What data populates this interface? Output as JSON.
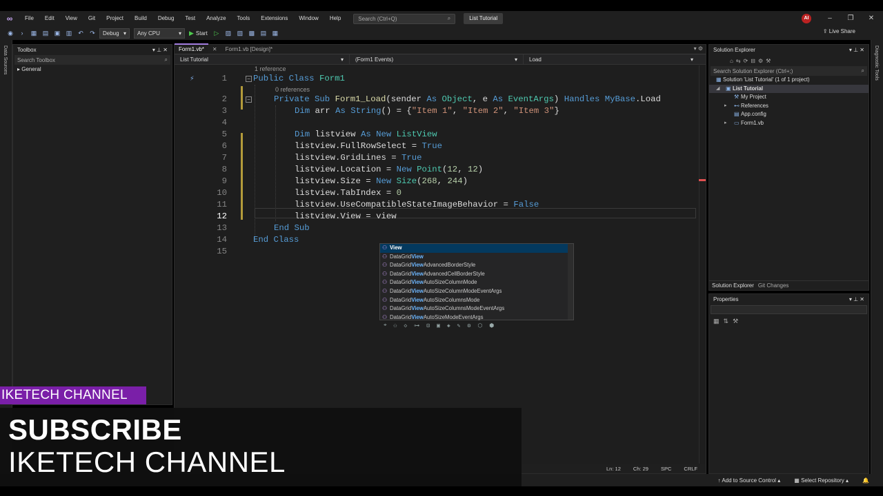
{
  "menu": {
    "items": [
      "File",
      "Edit",
      "View",
      "Git",
      "Project",
      "Build",
      "Debug",
      "Test",
      "Analyze",
      "Tools",
      "Extensions",
      "Window",
      "Help"
    ],
    "search_placeholder": "Search (Ctrl+Q)",
    "solution_name": "List Tutorial",
    "avatar": "AI"
  },
  "toolbar": {
    "config": "Debug",
    "platform": "Any CPU",
    "start_label": "Start",
    "live_share": "Live Share"
  },
  "left_strip": {
    "label": "Data Sources"
  },
  "right_strip": {
    "label": "Diagnostic Tools"
  },
  "toolbox": {
    "title": "Toolbox",
    "search_placeholder": "Search Toolbox",
    "group": "General"
  },
  "editor": {
    "tabs": [
      "Form1.vb*",
      "Form1.vb [Design]*"
    ],
    "nav": [
      "List Tutorial",
      "(Form1 Events)",
      "Load"
    ],
    "refs": {
      "r1": "1 reference",
      "r2": "0 references"
    },
    "line_numbers": [
      "1",
      "2",
      "3",
      "4",
      "5",
      "6",
      "7",
      "8",
      "9",
      "10",
      "11",
      "12",
      "13",
      "14",
      "15"
    ],
    "lines": {
      "l1_kw": "Public Class ",
      "l1_cls": "Form1",
      "l2_kw1": "Private Sub ",
      "l2_fn": "Form1_Load",
      "l2_p1": "(sender ",
      "l2_kw2": "As ",
      "l2_cls1": "Object",
      "l2_p2": ", e ",
      "l2_kw3": "As ",
      "l2_cls2": "EventArgs",
      "l2_p3": ") ",
      "l2_kw4": "Handles ",
      "l2_kw5": "MyBase",
      "l2_p4": ".Load",
      "l3_kw1": "Dim ",
      "l3_p1": "arr ",
      "l3_kw2": "As ",
      "l3_kw3": "String",
      "l3_p2": "() = {",
      "l3_s1": "\"Item 1\"",
      "l3_p3": ", ",
      "l3_s2": "\"Item 2\"",
      "l3_p4": ", ",
      "l3_s3": "\"Item 3\"",
      "l3_p5": "}",
      "l5_kw1": "Dim ",
      "l5_p1": "listview ",
      "l5_kw2": "As ",
      "l5_kw3": "New ",
      "l5_cls": "ListView",
      "l6_p": "listview.FullRowSelect = ",
      "l6_kw": "True",
      "l7_p": "listview.GridLines = ",
      "l7_kw": "True",
      "l8_p": "listview.Location = ",
      "l8_kw": "New ",
      "l8_cls": "Point",
      "l8_p2": "(",
      "l8_n1": "12",
      "l8_p3": ", ",
      "l8_n2": "12",
      "l8_p4": ")",
      "l9_p": "listview.Size = ",
      "l9_kw": "New ",
      "l9_cls": "Size",
      "l9_p2": "(",
      "l9_n1": "268",
      "l9_p3": ", ",
      "l9_n2": "244",
      "l9_p4": ")",
      "l10_p": "listview.TabIndex = ",
      "l10_n": "0",
      "l11_p": "listview.UseCompatibleStateImageBehavior = ",
      "l11_kw": "False",
      "l12_p": "listview.View = view",
      "l13_kw": "End Sub",
      "l14_kw": "End Class"
    }
  },
  "intellisense": {
    "items": [
      {
        "pre": "",
        "match": "View",
        "post": ""
      },
      {
        "pre": "DataGrid",
        "match": "View",
        "post": ""
      },
      {
        "pre": "DataGrid",
        "match": "View",
        "post": "AdvancedBorderStyle"
      },
      {
        "pre": "DataGrid",
        "match": "View",
        "post": "AdvancedCellBorderStyle"
      },
      {
        "pre": "DataGrid",
        "match": "View",
        "post": "AutoSizeColumnMode"
      },
      {
        "pre": "DataGrid",
        "match": "View",
        "post": "AutoSizeColumnModeEventArgs"
      },
      {
        "pre": "DataGrid",
        "match": "View",
        "post": "AutoSizeColumnsMode"
      },
      {
        "pre": "DataGrid",
        "match": "View",
        "post": "AutoSizeColumnsModeEventArgs"
      },
      {
        "pre": "DataGrid",
        "match": "View",
        "post": "AutoSizeModeEventArgs"
      }
    ]
  },
  "solution_explorer": {
    "title": "Solution Explorer",
    "search_placeholder": "Search Solution Explorer (Ctrl+;)",
    "tree": {
      "solution": "Solution 'List Tutorial' (1 of 1 project)",
      "project": "List Tutorial",
      "my_project": "My Project",
      "references": "References",
      "app_config": "App.config",
      "form1": "Form1.vb"
    },
    "tabs": [
      "Solution Explorer",
      "Git Changes"
    ]
  },
  "properties": {
    "title": "Properties"
  },
  "status": {
    "line": "Ln: 12",
    "col": "Ch: 29",
    "spc": "SPC",
    "crlf": "CRLF",
    "add_source": "Add to Source Control",
    "select_repo": "Select Repository"
  },
  "overlay": {
    "tag": "IKETECH CHANNEL",
    "subscribe": "SUBSCRIBE",
    "channel": "IKETECH CHANNEL"
  }
}
